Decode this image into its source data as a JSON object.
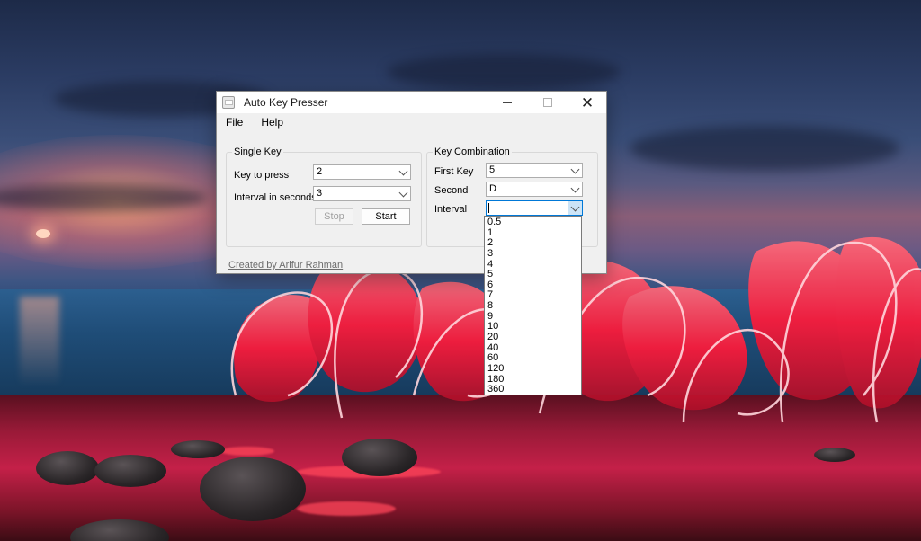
{
  "window": {
    "title": "Auto Key Presser",
    "controls": {
      "minimize": "minimize",
      "maximize": "maximize",
      "close": "✕"
    }
  },
  "menu": {
    "file": "File",
    "help": "Help"
  },
  "single_key": {
    "group_title": "Single Key",
    "key_label": "Key to press",
    "key_value": "2",
    "interval_label": "Interval in seconds",
    "interval_value": "3",
    "stop_label": "Stop",
    "start_label": "Start"
  },
  "key_combination": {
    "group_title": "Key Combination",
    "first_key_label": "First Key",
    "first_key_value": "5",
    "second_label": "Second",
    "second_value": "D",
    "interval_label": "Interval",
    "interval_value": ""
  },
  "interval_options": [
    "0.5",
    "1",
    "2",
    "3",
    "4",
    "5",
    "6",
    "7",
    "8",
    "9",
    "10",
    "20",
    "40",
    "60",
    "120",
    "180",
    "360"
  ],
  "footer": {
    "credit": "Created by Arifur Rahman"
  },
  "colors": {
    "accent": "#0078d7",
    "window_bg": "#f0f0f0",
    "ribbon": "#ff2a4a"
  }
}
